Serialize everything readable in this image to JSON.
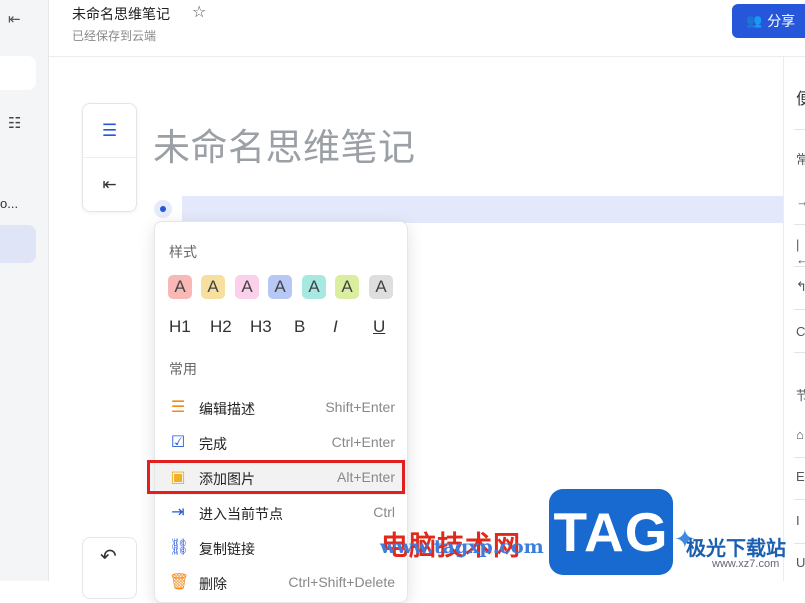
{
  "sidebar": {
    "collapse_glyph": "⇤",
    "truncated_item": "o...",
    "list_glyph": "☷"
  },
  "header": {
    "title": "未命名思维笔记",
    "star_glyph": "☆",
    "save_status": "已经保存到云端",
    "share_label": "分享",
    "share_icon": "users-icon"
  },
  "right_panel": {
    "items": [
      "便",
      "常",
      "→",
      "|←",
      "↰",
      "C",
      "节",
      "⌂",
      "E",
      "I",
      "U"
    ]
  },
  "toolbar": {
    "outline_glyph": "☰",
    "indent_glyph": "⇤"
  },
  "canvas": {
    "map_title": "未命名思维笔记"
  },
  "menu": {
    "style_label": "样式",
    "swatches": [
      {
        "letter": "A",
        "color": "#f8b8b6"
      },
      {
        "letter": "A",
        "color": "#f7dfa0"
      },
      {
        "letter": "A",
        "color": "#fbd0ea"
      },
      {
        "letter": "A",
        "color": "#b8c8f4"
      },
      {
        "letter": "A",
        "color": "#a7e9e0"
      },
      {
        "letter": "A",
        "color": "#dbeea0"
      },
      {
        "letter": "A",
        "color": "#dedede"
      }
    ],
    "formats": [
      "H1",
      "H2",
      "H3",
      "B",
      "I",
      "U"
    ],
    "common_label": "常用",
    "items": [
      {
        "icon": "edit-description-icon",
        "glyph": "☰",
        "label": "编辑描述",
        "shortcut": "Shift+Enter",
        "color": "#f08a1c"
      },
      {
        "icon": "checkbox-icon",
        "glyph": "☑",
        "label": "完成",
        "shortcut": "Ctrl+Enter",
        "color": "#2656d9"
      },
      {
        "icon": "image-icon",
        "glyph": "▣",
        "label": "添加图片",
        "shortcut": "Alt+Enter",
        "color": "#f0b020"
      },
      {
        "icon": "enter-node-icon",
        "glyph": "⇥",
        "label": "进入当前节点",
        "shortcut": "Ctrl",
        "color": "#2656d9"
      },
      {
        "icon": "link-icon",
        "glyph": "⛓",
        "label": "复制链接",
        "shortcut": "",
        "color": "#2656d9"
      },
      {
        "icon": "trash-icon",
        "glyph": "🗑",
        "label": "删除",
        "shortcut": "Ctrl+Shift+Delete",
        "color": "#f08a1c"
      }
    ]
  },
  "undo": {
    "glyph": "↶"
  },
  "watermark": {
    "cn": "电脑技术网",
    "url": "www.tagxp.com",
    "tag": "TAG",
    "site_cn": "极光下载站",
    "site_url": "www.xz7.com"
  }
}
